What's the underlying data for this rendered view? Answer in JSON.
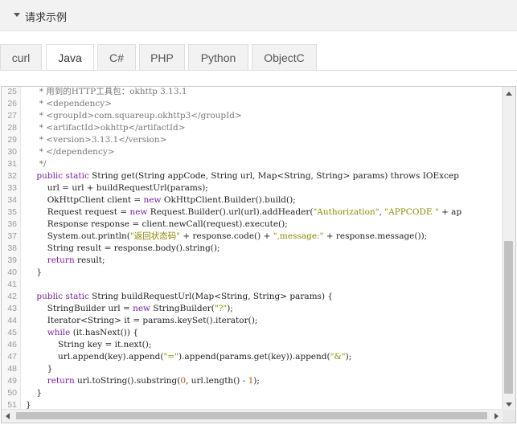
{
  "section": {
    "title": "请求示例"
  },
  "tabs": [
    {
      "label": "curl"
    },
    {
      "label": "Java"
    },
    {
      "label": "C#"
    },
    {
      "label": "PHP"
    },
    {
      "label": "Python"
    },
    {
      "label": "ObjectC"
    }
  ],
  "active_tab": "Java",
  "code": {
    "lines": [
      {
        "num": "25",
        "segments": [
          {
            "t": "     * 用到的HTTP工具包：okhttp 3.13.1",
            "c": "cm"
          }
        ]
      },
      {
        "num": "26",
        "segments": [
          {
            "t": "     * <dependency>",
            "c": "cm"
          }
        ]
      },
      {
        "num": "27",
        "segments": [
          {
            "t": "     * <groupId>com.squareup.okhttp3</groupId>",
            "c": "cm"
          }
        ]
      },
      {
        "num": "28",
        "segments": [
          {
            "t": "     * <artifactId>okhttp</artifactId>",
            "c": "cm"
          }
        ]
      },
      {
        "num": "29",
        "segments": [
          {
            "t": "     * <version>3.13.1</version>",
            "c": "cm"
          }
        ]
      },
      {
        "num": "30",
        "segments": [
          {
            "t": "     * </dependency>",
            "c": "cm"
          }
        ]
      },
      {
        "num": "31",
        "segments": [
          {
            "t": "     */",
            "c": "cm"
          }
        ]
      },
      {
        "num": "32",
        "segments": [
          {
            "t": "    ",
            "c": ""
          },
          {
            "t": "public static",
            "c": "kw"
          },
          {
            "t": " String get(String appCode, String url, Map<String, String> params) throws IOExcep",
            "c": ""
          }
        ]
      },
      {
        "num": "33",
        "segments": [
          {
            "t": "        url = url + buildRequestUrl(params);",
            "c": ""
          }
        ]
      },
      {
        "num": "34",
        "segments": [
          {
            "t": "        OkHttpClient client = ",
            "c": ""
          },
          {
            "t": "new",
            "c": "kw"
          },
          {
            "t": " OkHttpClient.Builder().build();",
            "c": ""
          }
        ]
      },
      {
        "num": "35",
        "segments": [
          {
            "t": "        Request request = ",
            "c": ""
          },
          {
            "t": "new",
            "c": "kw"
          },
          {
            "t": " Request.Builder().url(url).addHeader(",
            "c": ""
          },
          {
            "t": "\"Authorization\"",
            "c": "st"
          },
          {
            "t": ", ",
            "c": ""
          },
          {
            "t": "\"APPCODE \"",
            "c": "st"
          },
          {
            "t": " + ap",
            "c": ""
          }
        ]
      },
      {
        "num": "36",
        "segments": [
          {
            "t": "        Response response = client.newCall(request).execute();",
            "c": ""
          }
        ]
      },
      {
        "num": "37",
        "segments": [
          {
            "t": "        System.out.println(",
            "c": ""
          },
          {
            "t": "\"返回状态码\"",
            "c": "st"
          },
          {
            "t": " + response.code() + ",
            "c": ""
          },
          {
            "t": "\",message:\"",
            "c": "st"
          },
          {
            "t": " + response.message());",
            "c": ""
          }
        ]
      },
      {
        "num": "38",
        "segments": [
          {
            "t": "        String result = response.body().string();",
            "c": ""
          }
        ]
      },
      {
        "num": "39",
        "segments": [
          {
            "t": "        ",
            "c": ""
          },
          {
            "t": "return",
            "c": "kw"
          },
          {
            "t": " result;",
            "c": ""
          }
        ]
      },
      {
        "num": "40",
        "segments": [
          {
            "t": "    }",
            "c": ""
          }
        ]
      },
      {
        "num": "41",
        "segments": [
          {
            "t": "",
            "c": ""
          }
        ]
      },
      {
        "num": "42",
        "segments": [
          {
            "t": "    ",
            "c": ""
          },
          {
            "t": "public static",
            "c": "kw"
          },
          {
            "t": " String buildRequestUrl(Map<String, String> params) {",
            "c": ""
          }
        ]
      },
      {
        "num": "43",
        "segments": [
          {
            "t": "        StringBuilder url = ",
            "c": ""
          },
          {
            "t": "new",
            "c": "kw"
          },
          {
            "t": " StringBuilder(",
            "c": ""
          },
          {
            "t": "\"?\"",
            "c": "st"
          },
          {
            "t": ");",
            "c": ""
          }
        ]
      },
      {
        "num": "44",
        "segments": [
          {
            "t": "        Iterator<String> it = params.keySet().iterator();",
            "c": ""
          }
        ]
      },
      {
        "num": "45",
        "segments": [
          {
            "t": "        ",
            "c": ""
          },
          {
            "t": "while",
            "c": "kw"
          },
          {
            "t": " (it.hasNext()) {",
            "c": ""
          }
        ]
      },
      {
        "num": "46",
        "segments": [
          {
            "t": "            String key = it.next();",
            "c": ""
          }
        ]
      },
      {
        "num": "47",
        "segments": [
          {
            "t": "            url.append(key).append(",
            "c": ""
          },
          {
            "t": "\"=\"",
            "c": "st"
          },
          {
            "t": ").append(params.get(key)).append(",
            "c": ""
          },
          {
            "t": "\"&\"",
            "c": "st"
          },
          {
            "t": ");",
            "c": ""
          }
        ]
      },
      {
        "num": "48",
        "segments": [
          {
            "t": "        }",
            "c": ""
          }
        ]
      },
      {
        "num": "49",
        "segments": [
          {
            "t": "        ",
            "c": ""
          },
          {
            "t": "return",
            "c": "kw"
          },
          {
            "t": " url.toString().substring(",
            "c": ""
          },
          {
            "t": "0",
            "c": "nm"
          },
          {
            "t": ", url.length() - ",
            "c": ""
          },
          {
            "t": "1",
            "c": "nm"
          },
          {
            "t": ");",
            "c": ""
          }
        ]
      },
      {
        "num": "50",
        "segments": [
          {
            "t": "    }",
            "c": ""
          }
        ]
      },
      {
        "num": "51",
        "segments": [
          {
            "t": "}",
            "c": ""
          }
        ]
      }
    ]
  },
  "colors": {
    "comment": "#777777",
    "keyword": "#7b1fa2",
    "string": "#8a8a00",
    "number": "#b35900"
  },
  "icons": {
    "section_toggle": "caret-down-icon",
    "scroll_up": "arrow-up-icon",
    "scroll_down": "arrow-down-icon",
    "scroll_left": "arrow-left-icon",
    "scroll_right": "arrow-right-icon"
  }
}
